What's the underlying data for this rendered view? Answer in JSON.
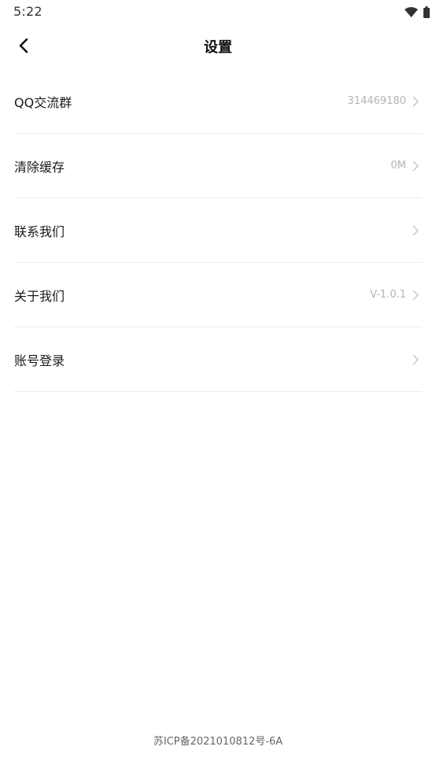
{
  "status_bar": {
    "time": "5:22",
    "icons": [
      "wifi-icon",
      "battery-icon"
    ]
  },
  "header": {
    "back_icon": "chevron-left-icon",
    "title": "设置"
  },
  "settings": [
    {
      "label": "QQ交流群",
      "value": "314469180"
    },
    {
      "label": "清除缓存",
      "value": "0M"
    },
    {
      "label": "联系我们",
      "value": ""
    },
    {
      "label": "关于我们",
      "value": "V-1.0.1"
    },
    {
      "label": "账号登录",
      "value": ""
    }
  ],
  "footer": {
    "icp": "苏ICP备2021010812号-6A"
  },
  "colors": {
    "background": "#ffffff",
    "text_primary": "#1a1a1a",
    "text_secondary": "#b4b4b4",
    "divider": "#ececec",
    "chevron": "#c4c4c4"
  }
}
